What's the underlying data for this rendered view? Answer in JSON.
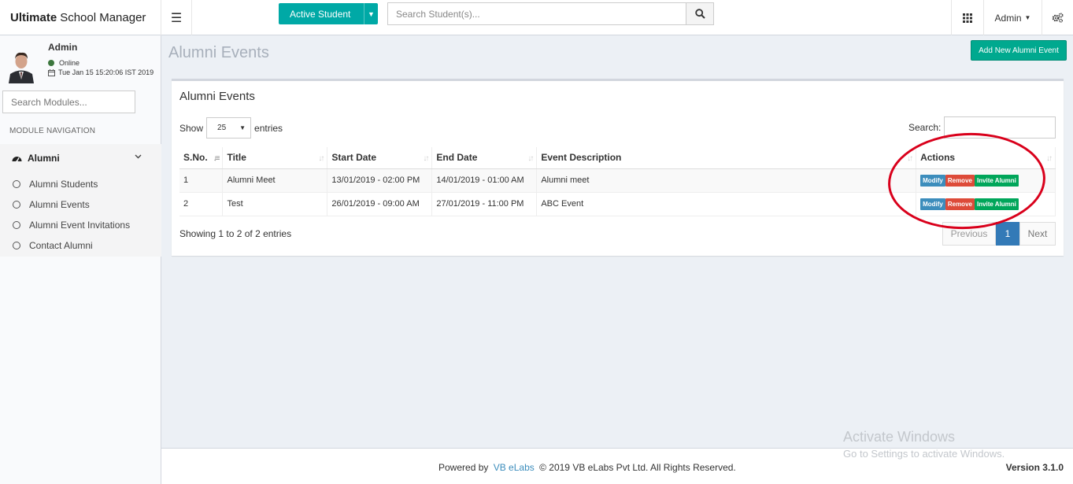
{
  "header": {
    "brand_bold": "Ultimate",
    "brand_rest": "School Manager",
    "active_student_label": "Active Student",
    "search_placeholder": "Search Student(s)...",
    "admin_label": "Admin"
  },
  "user": {
    "name": "Admin",
    "status": "Online",
    "date": "Tue Jan 15 15:20:06 IST 2019"
  },
  "sidebar": {
    "search_placeholder": "Search Modules...",
    "nav_header": "MODULE NAVIGATION",
    "group_label": "Alumni",
    "items": [
      {
        "label": "Alumni Students"
      },
      {
        "label": "Alumni Events"
      },
      {
        "label": "Alumni Event Invitations"
      },
      {
        "label": "Contact Alumni"
      }
    ]
  },
  "page": {
    "title": "Alumni Events",
    "add_button": "Add New Alumni Event"
  },
  "box": {
    "title": "Alumni Events",
    "show_label": "Show",
    "entries_label": "entries",
    "page_length": "25",
    "search_label": "Search:",
    "columns": [
      "S.No.",
      "Title",
      "Start Date",
      "End Date",
      "Event Description",
      "Actions"
    ],
    "rows": [
      {
        "sno": "1",
        "title": "Alumni Meet",
        "start": "13/01/2019 - 02:00 PM",
        "end": "14/01/2019 - 01:00 AM",
        "desc": "Alumni meet"
      },
      {
        "sno": "2",
        "title": "Test",
        "start": "26/01/2019 - 09:00 AM",
        "end": "27/01/2019 - 11:00 PM",
        "desc": "ABC Event"
      }
    ],
    "actions": {
      "modify": "Modify",
      "remove": "Remove",
      "invite": "Invite Alumni"
    },
    "info": "Showing 1 to 2 of 2 entries",
    "pagination": {
      "previous": "Previous",
      "current": "1",
      "next": "Next"
    }
  },
  "footer": {
    "powered_by": "Powered by",
    "vb_link": "VB eLabs",
    "copyright": "© 2019 VB eLabs Pvt Ltd. All Rights Reserved.",
    "version": "Version 3.1.0"
  },
  "watermark": {
    "line1": "Activate Windows",
    "line2": "Go to Settings to activate Windows."
  },
  "colors": {
    "teal": "#00a9a6",
    "add_button": "#00a98f",
    "modify": "#3c8dbc",
    "remove": "#dd4b39",
    "invite": "#00a65a",
    "annotation": "#d9001b"
  }
}
